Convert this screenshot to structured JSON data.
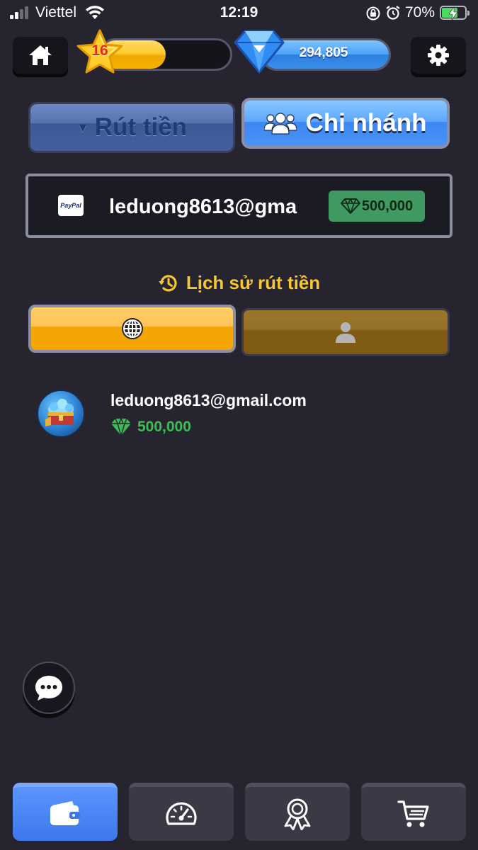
{
  "status_bar": {
    "carrier": "Viettel",
    "time": "12:19",
    "battery_percent": "70%",
    "battery_level": 0.7
  },
  "header": {
    "level": "16",
    "xp_progress": 0.5,
    "gems": "294,805",
    "icons": [
      "home-icon",
      "star-icon",
      "diamond-icon",
      "gear-icon"
    ]
  },
  "tabs": {
    "withdraw_label": "Rút tiền",
    "branch_label": "Chi nhánh",
    "active": "branch"
  },
  "account": {
    "method": "PayPal",
    "email": "leduong8613@gma",
    "amount": "500,000"
  },
  "history": {
    "title": "Lịch sử rút tiền",
    "active_filter": "global",
    "filter_icons": [
      "globe-icon",
      "person-icon"
    ],
    "items": [
      {
        "email": "leduong8613@gmail.com",
        "amount": "500,000"
      }
    ]
  },
  "bottom_nav": {
    "items": [
      "wallet-icon",
      "speedometer-icon",
      "award-icon",
      "cart-icon"
    ],
    "active": "wallet"
  },
  "colors": {
    "background": "#25242f",
    "accent_blue": "#4a93f8",
    "accent_yellow": "#f6c633",
    "gem_green": "#3dbe55"
  }
}
